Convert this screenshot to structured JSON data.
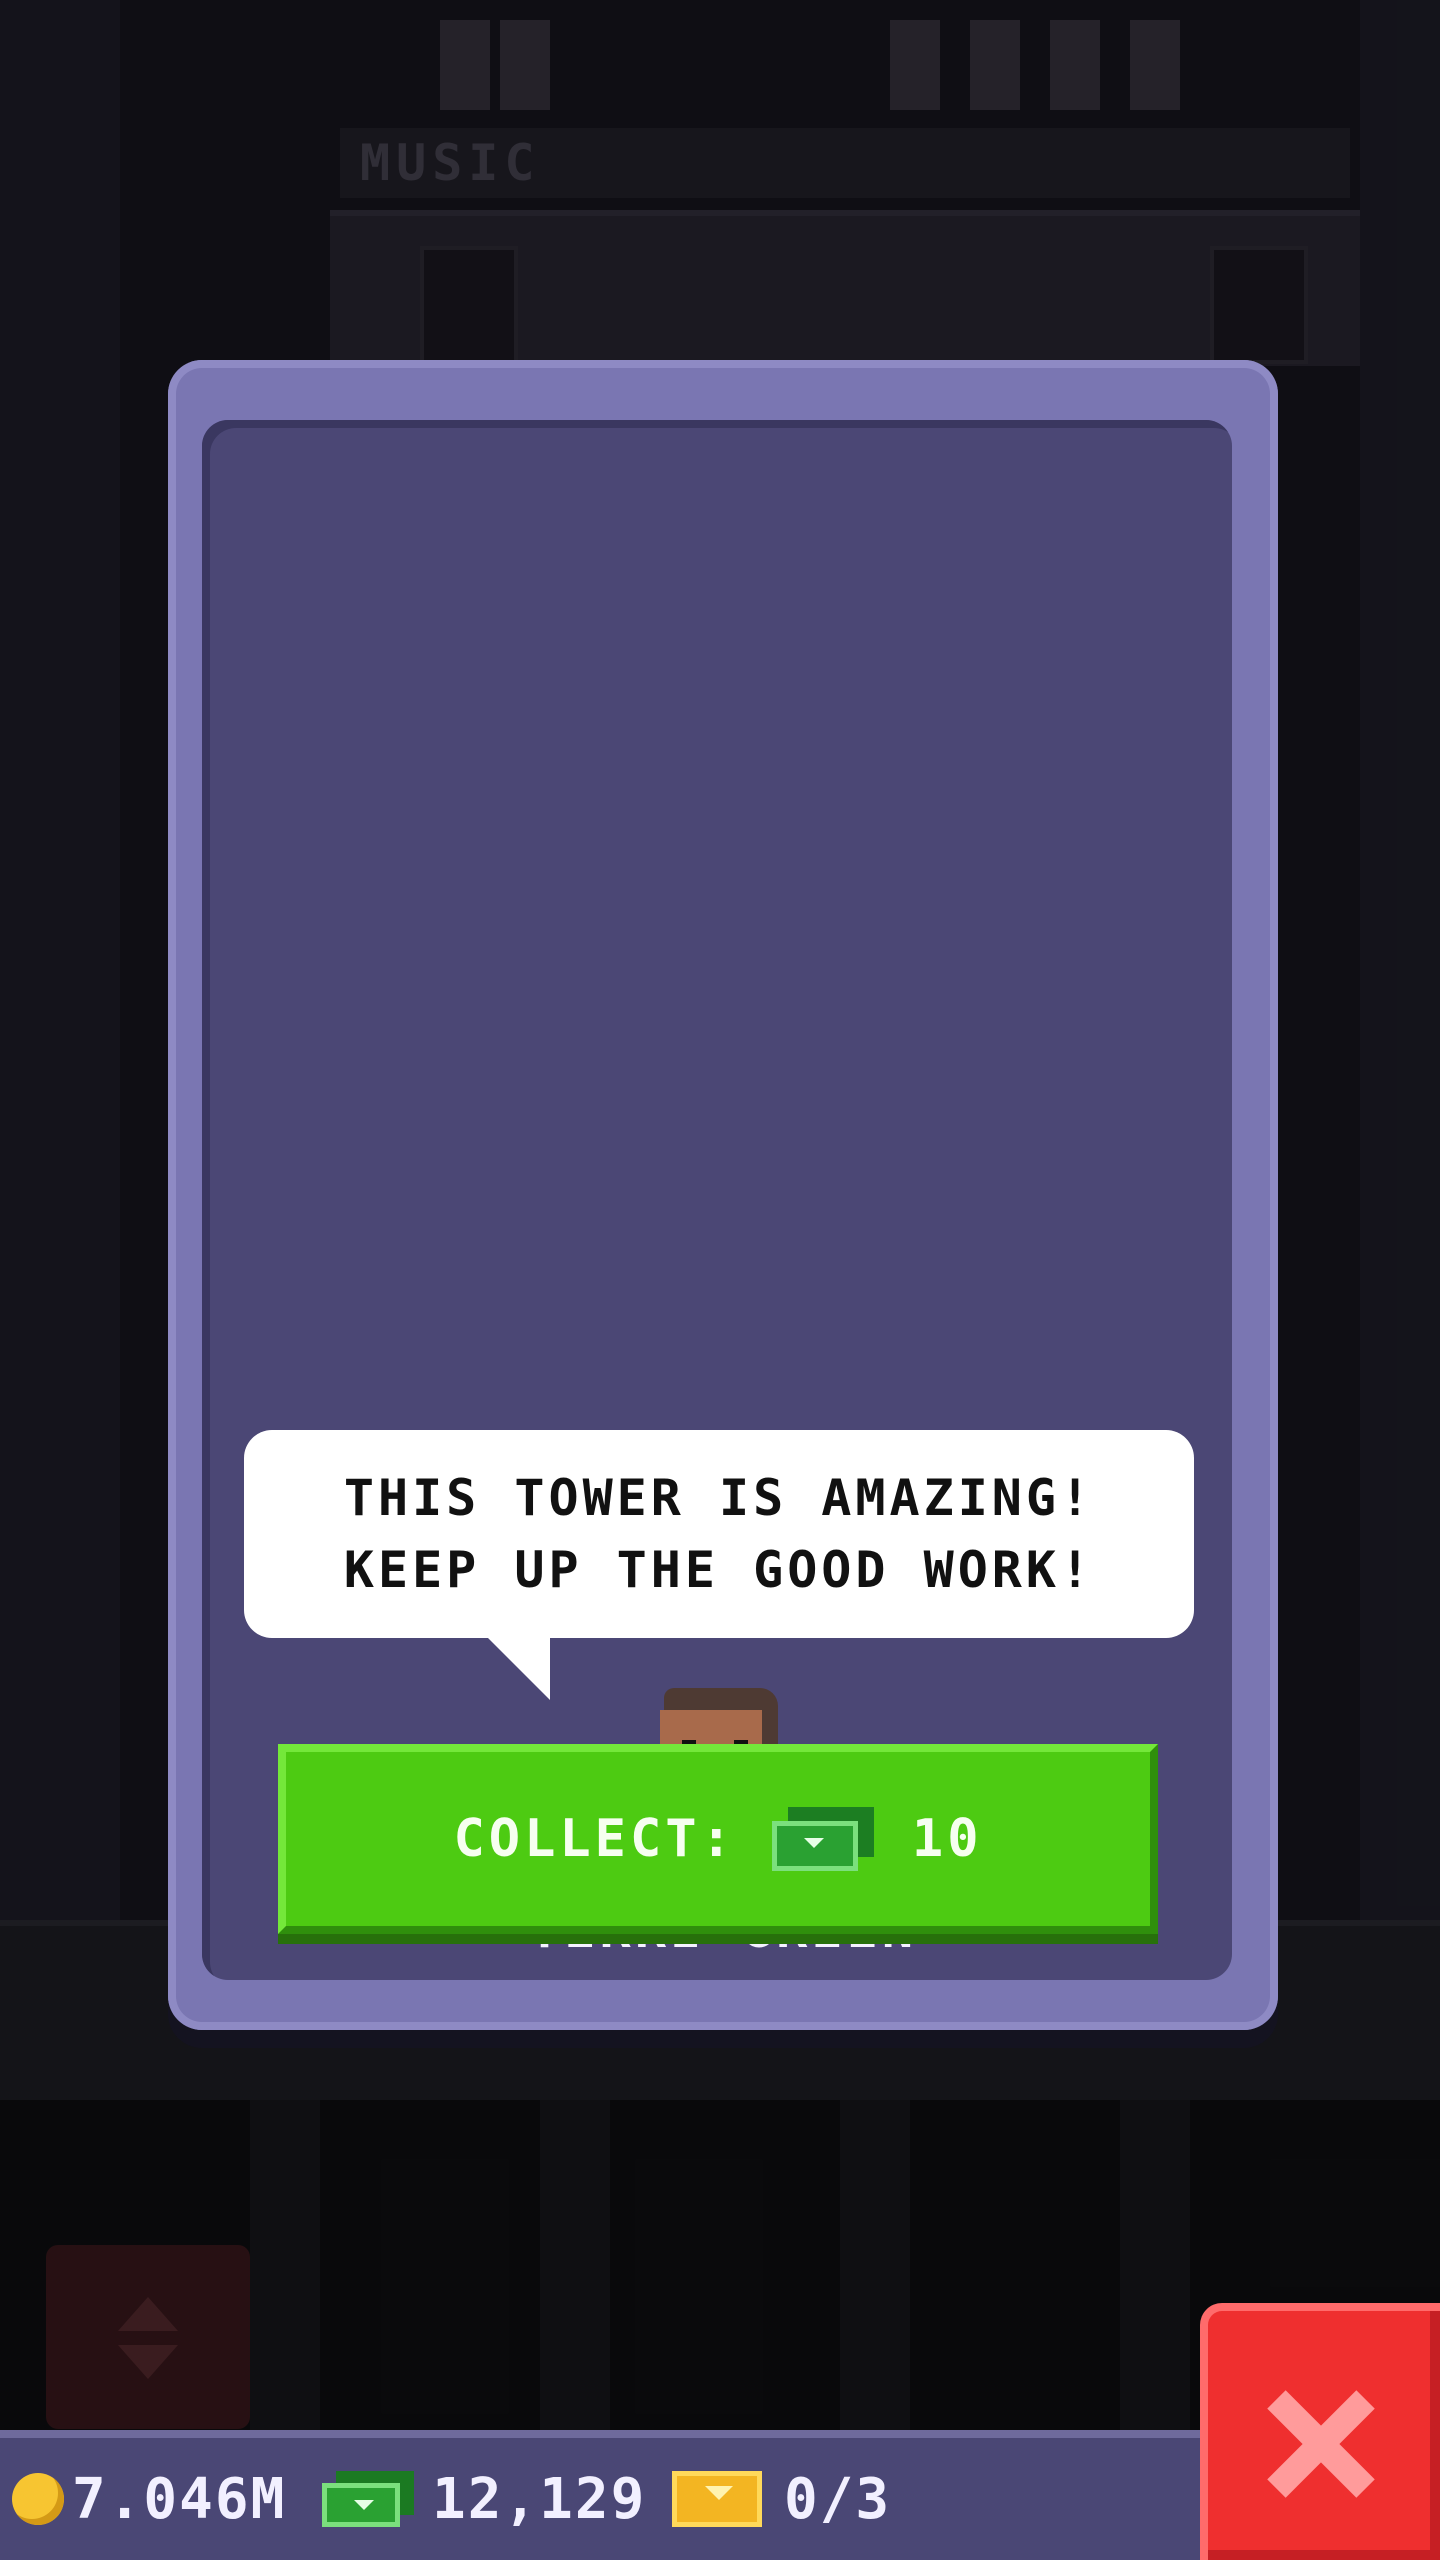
{
  "background": {
    "floor_label": "MUSIC"
  },
  "dialog": {
    "speech_line1": "THIS TOWER IS AMAZING!",
    "speech_line2": "KEEP UP THE GOOD WORK!",
    "character_name": "TERRI GREEN",
    "collect_label": "COLLECT:",
    "collect_amount": "10",
    "collect_icon": "bux-icon"
  },
  "status_bar": {
    "coins": "7.046M",
    "coins_icon": "coin-icon",
    "bux": "12,129",
    "bux_icon": "bux-icon",
    "tickets": "0/3",
    "tickets_icon": "golden-ticket-icon"
  },
  "colors": {
    "dialog_frame": "#7a76b2",
    "dialog_panel": "#4b4775",
    "collect_button": "#4dcb12",
    "close_button": "#ef2f2f",
    "status_bar": "#4a4775"
  }
}
